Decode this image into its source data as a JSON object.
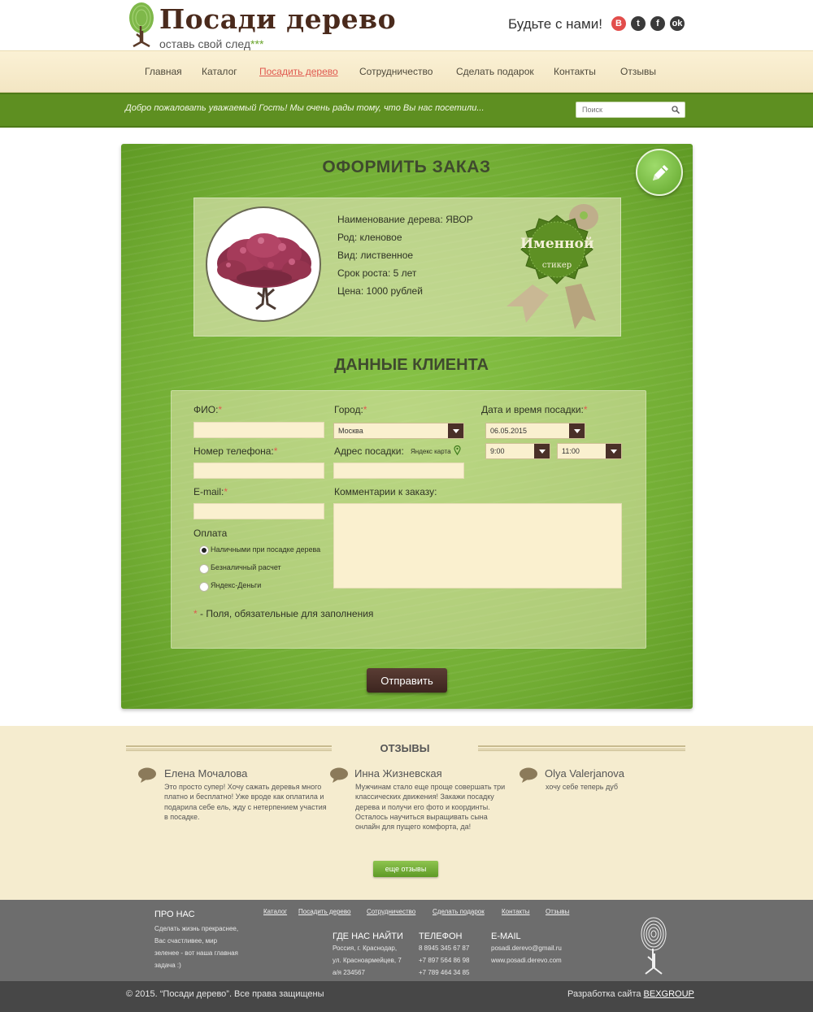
{
  "header": {
    "logo_title": "Посади дерево",
    "logo_subtitle": "оставь свой след",
    "logo_stars": "***",
    "follow_text": "Будьте с нами!",
    "social": [
      {
        "icon": "vk-icon",
        "glyph": "В",
        "color": "#e24d4b"
      },
      {
        "icon": "twitter-icon",
        "glyph": "t",
        "color": "#3a3a3a"
      },
      {
        "icon": "facebook-icon",
        "glyph": "f",
        "color": "#3a3a3a"
      },
      {
        "icon": "odnoklassniki-icon",
        "glyph": "ok",
        "color": "#3a3a3a"
      }
    ]
  },
  "nav": {
    "items": [
      "Главная",
      "Каталог",
      "Посадить дерево",
      "Сотрудничество",
      "Сделать подарок",
      "Контакты",
      "Отзывы"
    ],
    "active": "Посадить дерево"
  },
  "welcome": {
    "text": "Добро пожаловать уважаемый Гость!  Мы очень рады тому, что Вы нас посетили...",
    "search_placeholder": "Поиск"
  },
  "order": {
    "title": "ОФОРМИТЬ ЗАКАЗ",
    "product": {
      "name_line": "Наименование дерева:  ЯВОР",
      "genus_line": "Род: кленовое",
      "type_line": "Вид: лиственное",
      "growth_line": "Срок роста: 5 лет",
      "price_line": "Цена: 1000 рублей"
    },
    "sticker_line1": "Именной",
    "sticker_line2": "стикер"
  },
  "client": {
    "title": "ДАННЫЕ КЛИЕНТА",
    "fio_label": "ФИО:",
    "phone_label": "Номер телефона:",
    "email_label": "E-mail:",
    "city_label": "Город:",
    "city_value": "Москва",
    "address_label": "Адрес посадки:",
    "map_link": "Яндекс карта",
    "datetime_label": "Дата и время посадки:",
    "date_value": "06.05.2015",
    "time_from": "9:00",
    "time_to": "11:00",
    "comments_label": "Комментарии к заказу:",
    "payment_label": "Оплата",
    "payment_options": [
      "Наличными при посадке дерева",
      "Безналичный расчет",
      "Яндекс-Деньги"
    ],
    "payment_selected": "Наличными при посадке дерева",
    "required_mark": "*",
    "required_note": " - Поля, обязательные для заполнения",
    "submit_label": "Отправить"
  },
  "reviews": {
    "title": "ОТЗЫВЫ",
    "items": [
      {
        "name": "Елена Мочалова",
        "text": "Это просто супер! Хочу сажать деревья много платно и бесплатно! Уже вроде как оплатила и подарила себе ель, жду с нетерпением участия в посадке."
      },
      {
        "name": "Инна Жизневская",
        "text": "Мужчинам стало еще проще совершать три классических движения! Закажи посадку дерева и получи его фото и координты. Осталось научиться выращивать сына онлайн для пущего комфорта, да!"
      },
      {
        "name": "Olya Valerjanova",
        "text": "хочу себе теперь дуб"
      }
    ],
    "more_label": "еще отзывы"
  },
  "footer": {
    "about_title": "ПРО НАС",
    "about_lines": [
      "Сделать жизнь прекраснее,",
      "Вас счастливее, мир",
      "зеленее - вот наша главная",
      "задача :)"
    ],
    "links": [
      "Каталог",
      "Посадить дерево",
      "Сотрудничество",
      "Сделать подарок",
      "Контакты",
      "Отзывы"
    ],
    "where_title": "ГДЕ НАС НАЙТИ",
    "where_lines": [
      "Россия, г. Краснодар,",
      "ул. Красноармейцев, 7",
      "а/я 234567"
    ],
    "phone_title": "ТЕЛЕФОН",
    "phone_lines": [
      "8 8945 345 67 87",
      "+7 897 564 86 98",
      "+7 789 464 34 85"
    ],
    "email_title": "E-MAIL",
    "email_lines": [
      "posadi.derevo@gmail.ru",
      "www.posadi.derevo.com"
    ],
    "copyright": "© 2015. “Посади дерево”. Все права защищены",
    "dev_text": "Разработка сайта ",
    "dev_link": "BEXGROUP"
  },
  "colors": {
    "brand_green": "#5e8f21",
    "panel_green": "#72ad34",
    "accent_red": "#e0594f",
    "brown_button": "#4a3028",
    "cream": "#faf0cf"
  }
}
